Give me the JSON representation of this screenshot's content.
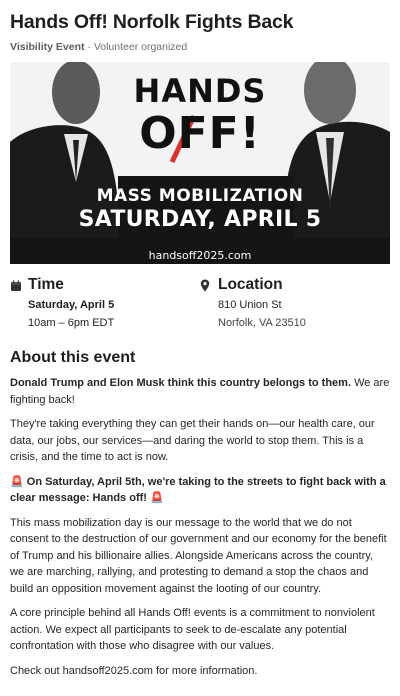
{
  "event": {
    "title": "Hands Off! Norfolk Fights Back",
    "type": "Visibility Event",
    "organizer": "· Volunteer organized"
  },
  "banner": {
    "line1": "HANDS",
    "line2": "OFF!",
    "line3": "MASS MOBILIZATION",
    "line4": "SATURDAY, APRIL 5",
    "url": "handsoff2025.com"
  },
  "time": {
    "heading": "Time",
    "date": "Saturday, April 5",
    "hours": "10am – 6pm EDT",
    "icon": "calendar-icon"
  },
  "location": {
    "heading": "Location",
    "street": "810 Union St",
    "city": "Norfolk, VA 23510",
    "icon": "map-pin-icon"
  },
  "about": {
    "heading": "About this event",
    "p1_bold": "Donald Trump and Elon Musk think this country belongs to them.",
    "p1_rest": " We are fighting back!",
    "p2": "They're taking everything they can get their hands on—our health care, our data, our jobs, our services—and daring the world to stop them. This is a crisis, and the time to act is now.",
    "p3_bold": "On Saturday, April 5th, we're taking to the streets to fight back with a clear message: Hands off!",
    "p4": "This mass mobilization day is our message to the world that we do not consent to the destruction of our government and our economy for the benefit of Trump and his billionaire allies. Alongside Americans across the country, we are marching, rallying, and protesting to demand a stop the chaos and build an opposition movement against the looting of our country.",
    "p5": "A core principle behind all Hands Off! events is a commitment to nonviolent action. We expect all participants to seek to de-escalate any potential confrontation with those who disagree with our values.",
    "p6": "Check out handsoff2025.com for more information.",
    "emoji_icon": "siren-icon"
  },
  "colors": {
    "accent_red": "#d9342b",
    "banner_dark": "#1a1a1a"
  }
}
